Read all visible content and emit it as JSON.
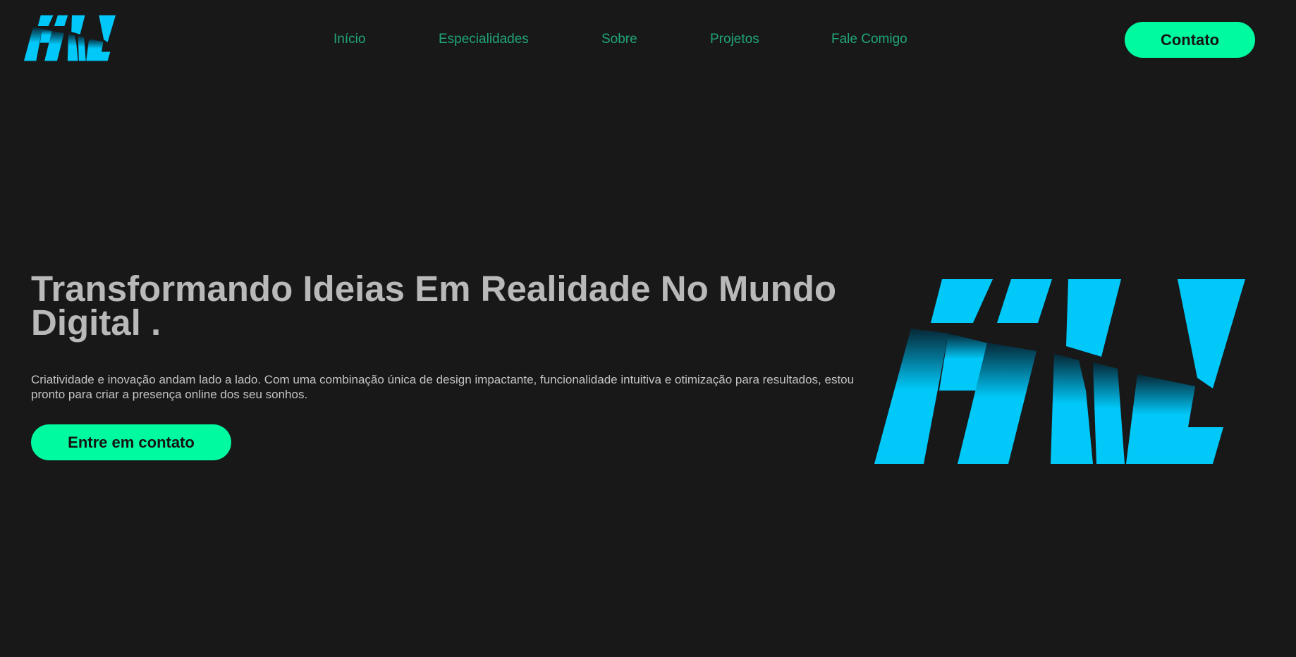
{
  "brand": {
    "logo_text": "HNL",
    "accent_color": "#00fa9f",
    "logo_color": "#00c8f8",
    "background_color": "#181818",
    "nav_link_color": "#1fa579"
  },
  "nav": {
    "items": [
      {
        "label": "Início"
      },
      {
        "label": "Especialidades"
      },
      {
        "label": "Sobre"
      },
      {
        "label": "Projetos"
      },
      {
        "label": "Fale Comigo"
      }
    ],
    "contact_button": "Contato"
  },
  "hero": {
    "title": "Transformando Ideias Em Realidade No Mundo Digital .",
    "description": "Criatividade e inovação andam lado a lado. Com uma combinação única de design impactante, funcionalidade intuitiva e otimização para resultados, estou pronto para criar a presença online dos seu sonhos.",
    "cta_button": "Entre em contato"
  }
}
